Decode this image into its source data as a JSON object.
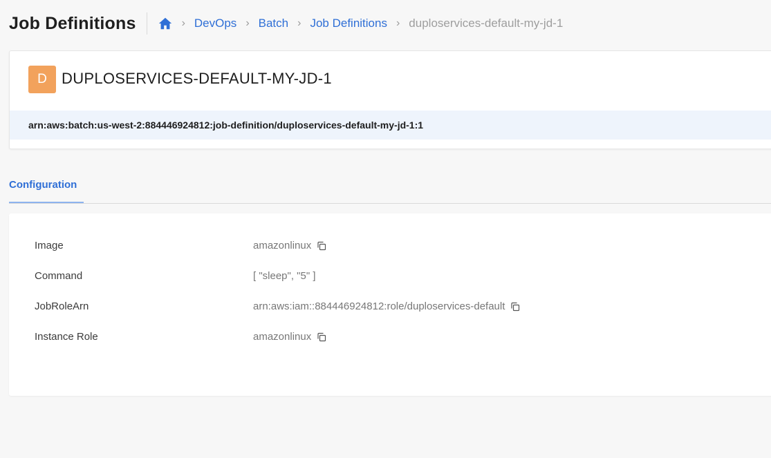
{
  "header": {
    "title": "Job Definitions",
    "breadcrumb": [
      "DevOps",
      "Batch",
      "Job Definitions"
    ],
    "current": "duploservices-default-my-jd-1"
  },
  "resource": {
    "avatar_letter": "D",
    "name": "DUPLOSERVICES-DEFAULT-MY-JD-1",
    "arn": "arn:aws:batch:us-west-2:884446924812:job-definition/duploservices-default-my-jd-1:1"
  },
  "tabs": [
    {
      "label": "Configuration",
      "active": true
    }
  ],
  "config": {
    "rows": [
      {
        "label": "Image",
        "value": "amazonlinux",
        "copyable": true
      },
      {
        "label": "Command",
        "value": "[ \"sleep\", \"5\" ]",
        "copyable": false
      },
      {
        "label": "JobRoleArn",
        "value": "arn:aws:iam::884446924812:role/duploservices-default",
        "copyable": true
      },
      {
        "label": "Instance Role",
        "value": "amazonlinux",
        "copyable": true
      }
    ]
  },
  "colors": {
    "accent": "#2f6fd6",
    "avatar": "#f2a25c",
    "arn_background": "#eef4fc"
  },
  "icons": [
    "home-icon",
    "chevron-right-icon",
    "copy-icon"
  ]
}
